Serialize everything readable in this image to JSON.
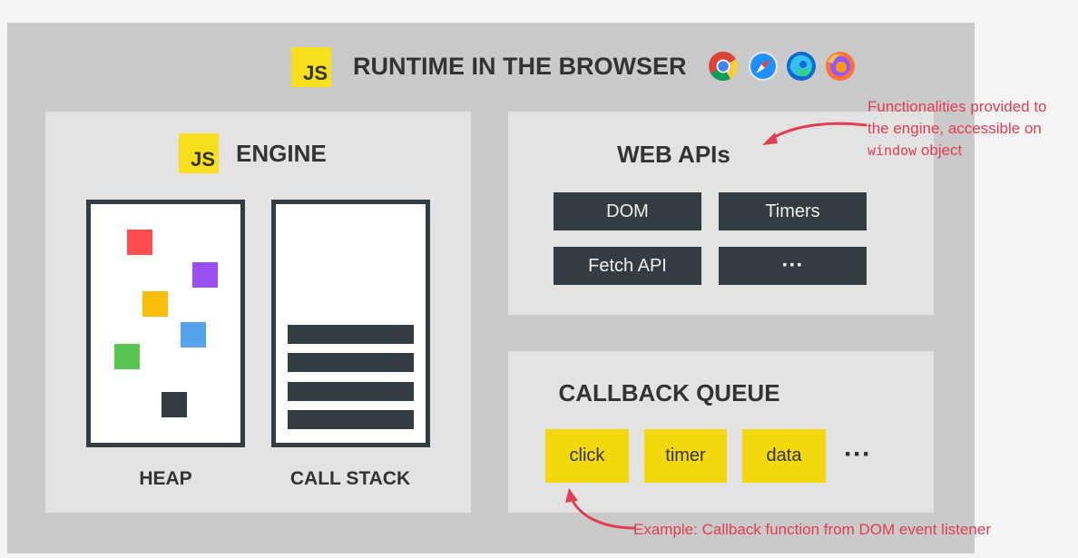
{
  "runtime": {
    "logo_text": "JS",
    "title": "RUNTIME IN THE BROWSER",
    "browsers": [
      "chrome-icon",
      "safari-icon",
      "edge-icon",
      "firefox-icon"
    ]
  },
  "engine": {
    "logo_text": "JS",
    "title": "ENGINE",
    "heap_label": "HEAP",
    "call_stack_label": "CALL STACK",
    "heap_colors": [
      "#ff4c4f",
      "#9b4ff0",
      "#fbbd08",
      "#57a2ec",
      "#5ac454",
      "#333c41"
    ]
  },
  "web_apis": {
    "title": "WEB APIs",
    "items": [
      "DOM",
      "Timers",
      "Fetch API",
      "···"
    ]
  },
  "callback_queue": {
    "title": "CALLBACK QUEUE",
    "items": [
      "click",
      "timer",
      "data"
    ],
    "ellipsis": "···"
  },
  "annotations": {
    "web_apis_note_line1": "Functionalities provided to",
    "web_apis_note_line2": "the engine, accessible on",
    "web_apis_note_code": "window",
    "web_apis_note_tail": " object",
    "callback_note": "Example: Callback function from DOM event listener"
  },
  "colors": {
    "accent_red": "#e03e55",
    "js_yellow": "#f7df1e",
    "dark": "#333c41",
    "queue_yellow": "#f2d80d"
  }
}
